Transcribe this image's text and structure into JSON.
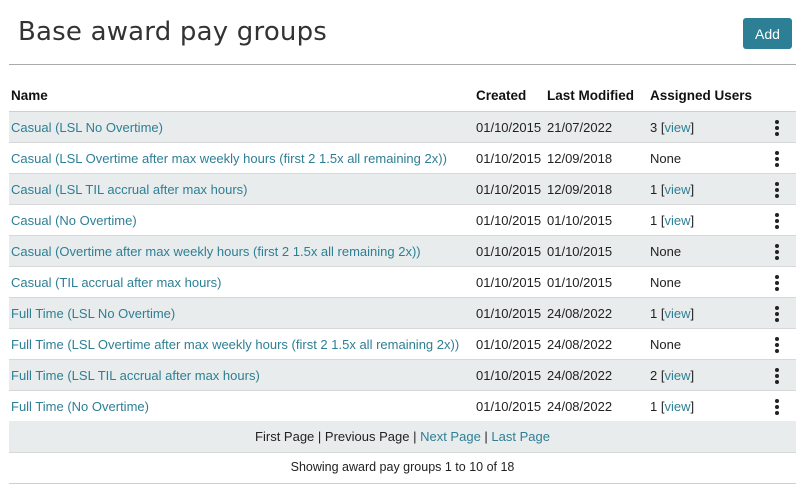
{
  "header": {
    "title": "Base award pay groups",
    "add_label": "Add"
  },
  "table": {
    "columns": [
      "Name",
      "Created",
      "Last Modified",
      "Assigned Users"
    ],
    "rows": [
      {
        "name": "Casual (LSL No Overtime)",
        "created": "01/10/2015",
        "modified": "21/07/2022",
        "users": "3",
        "view": "view"
      },
      {
        "name": "Casual (LSL Overtime after max weekly hours (first 2 1.5x all remaining 2x))",
        "created": "01/10/2015",
        "modified": "12/09/2018",
        "users": "None",
        "view": ""
      },
      {
        "name": "Casual (LSL TIL accrual after max hours)",
        "created": "01/10/2015",
        "modified": "12/09/2018",
        "users": "1",
        "view": "view"
      },
      {
        "name": "Casual (No Overtime)",
        "created": "01/10/2015",
        "modified": "01/10/2015",
        "users": "1",
        "view": "view"
      },
      {
        "name": "Casual (Overtime after max weekly hours (first 2 1.5x all remaining 2x))",
        "created": "01/10/2015",
        "modified": "01/10/2015",
        "users": "None",
        "view": ""
      },
      {
        "name": "Casual (TIL accrual after max hours)",
        "created": "01/10/2015",
        "modified": "01/10/2015",
        "users": "None",
        "view": ""
      },
      {
        "name": "Full Time (LSL No Overtime)",
        "created": "01/10/2015",
        "modified": "24/08/2022",
        "users": "1",
        "view": "view"
      },
      {
        "name": "Full Time (LSL Overtime after max weekly hours (first 2 1.5x all remaining 2x))",
        "created": "01/10/2015",
        "modified": "24/08/2022",
        "users": "None",
        "view": ""
      },
      {
        "name": "Full Time (LSL TIL accrual after max hours)",
        "created": "01/10/2015",
        "modified": "24/08/2022",
        "users": "2",
        "view": "view"
      },
      {
        "name": "Full Time (No Overtime)",
        "created": "01/10/2015",
        "modified": "24/08/2022",
        "users": "1",
        "view": "view"
      }
    ]
  },
  "pager": {
    "first": "First Page",
    "prev": "Previous Page",
    "next": "Next Page",
    "last": "Last Page",
    "sep": "|"
  },
  "status": {
    "showing": "Showing award pay groups 1 to 10 of 18"
  },
  "icons": {
    "row_menu": "more-vertical-icon"
  },
  "colors": {
    "accent": "#2d7f95",
    "row_alt": "#e9ecec"
  }
}
